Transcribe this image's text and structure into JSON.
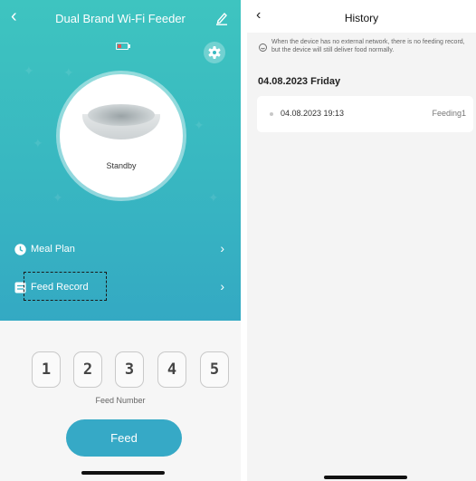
{
  "left": {
    "title": "Dual Brand Wi-Fi Feeder",
    "device_status": "Standby",
    "menu": [
      {
        "label": "Meal Plan"
      },
      {
        "label": "Feed Record"
      }
    ],
    "feed_numbers": [
      "1",
      "2",
      "3",
      "4",
      "5"
    ],
    "feed_number_label": "Feed Number",
    "feed_button": "Feed",
    "colors": {
      "teal_top": "#3ec4c0",
      "teal_bottom": "#34a9c3",
      "feed_button": "#36a9c6",
      "battery_low": "#e05656"
    },
    "icons": [
      "back-icon",
      "edit-icon",
      "battery-icon",
      "gear-icon",
      "clock-icon",
      "record-icon",
      "chevron-right-icon"
    ]
  },
  "right": {
    "title": "History",
    "info": "When the device has no external network, there is no feeding record, but the device will still deliver food normally.",
    "date_header": "04.08.2023 Friday",
    "records": [
      {
        "time": "04.08.2023 19:13",
        "label": "Feeding1"
      }
    ],
    "icons": [
      "back-icon",
      "info-icon"
    ]
  }
}
